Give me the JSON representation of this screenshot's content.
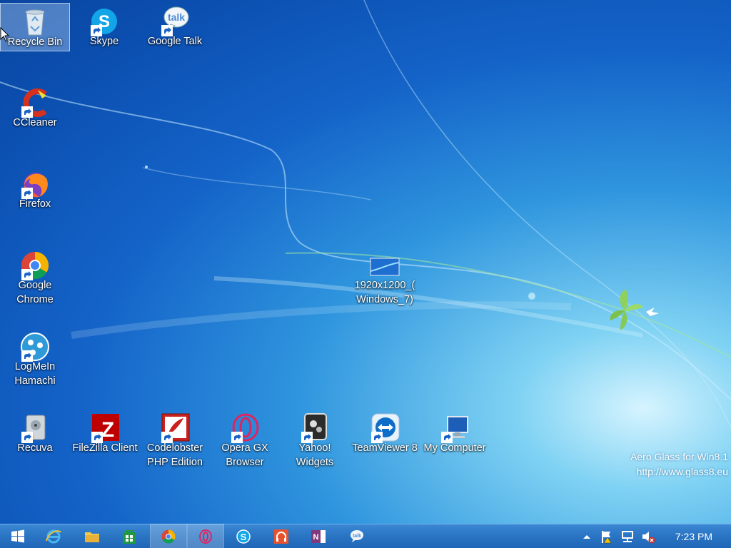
{
  "desktop": {
    "icons": [
      {
        "label": "Recycle Bin",
        "icon": "recycle-bin-icon",
        "selected": true
      },
      {
        "label": "Skype",
        "icon": "skype-icon"
      },
      {
        "label": "Google Talk",
        "icon": "google-talk-icon"
      },
      {
        "label": "CCleaner",
        "icon": "ccleaner-icon"
      },
      {
        "label": "Firefox",
        "icon": "firefox-icon"
      },
      {
        "label": "Google\nChrome",
        "icon": "chrome-icon"
      },
      {
        "label": "LogMeIn\nHamachi",
        "icon": "hamachi-icon"
      },
      {
        "label": "Recuva",
        "icon": "recuva-icon"
      },
      {
        "label": "FileZilla Client",
        "icon": "filezilla-icon"
      },
      {
        "label": "Codelobster\nPHP Edition",
        "icon": "codelobster-icon"
      },
      {
        "label": "Opera GX\nBrowser",
        "icon": "opera-gx-icon"
      },
      {
        "label": "Yahoo!\nWidgets",
        "icon": "yahoo-widgets-icon"
      },
      {
        "label": "TeamViewer 8",
        "icon": "teamviewer-icon"
      },
      {
        "label": "My Computer",
        "icon": "my-computer-icon"
      },
      {
        "label": "1920x1200_(\nWindows_7)",
        "icon": "image-file-icon"
      }
    ],
    "watermark": {
      "line1": "Aero Glass for Win8.1",
      "line2": "http://www.glass8.eu"
    }
  },
  "taskbar": {
    "buttons": [
      {
        "name": "Start",
        "icon": "windows-start-icon"
      },
      {
        "name": "Internet Explorer",
        "icon": "internet-explorer-icon"
      },
      {
        "name": "File Explorer",
        "icon": "file-explorer-icon"
      },
      {
        "name": "Store",
        "icon": "store-icon"
      },
      {
        "name": "Google Chrome",
        "icon": "chrome-icon",
        "active": true
      },
      {
        "name": "Opera GX",
        "icon": "opera-gx-icon",
        "active": true
      },
      {
        "name": "Skype",
        "icon": "skype-icon"
      },
      {
        "name": "Music",
        "icon": "headphones-icon"
      },
      {
        "name": "OneNote",
        "icon": "onenote-icon"
      },
      {
        "name": "Google Talk",
        "icon": "google-talk-icon"
      }
    ],
    "tray": {
      "icons": [
        "show-hidden-icons-icon",
        "action-center-flag-icon",
        "network-icon",
        "volume-muted-icon"
      ],
      "clock": "7:23 PM"
    }
  },
  "colors": {
    "taskbar": "#2a74c4",
    "wallpaper_dark": "#0b4fb0",
    "wallpaper_light": "#7fd2f3"
  }
}
